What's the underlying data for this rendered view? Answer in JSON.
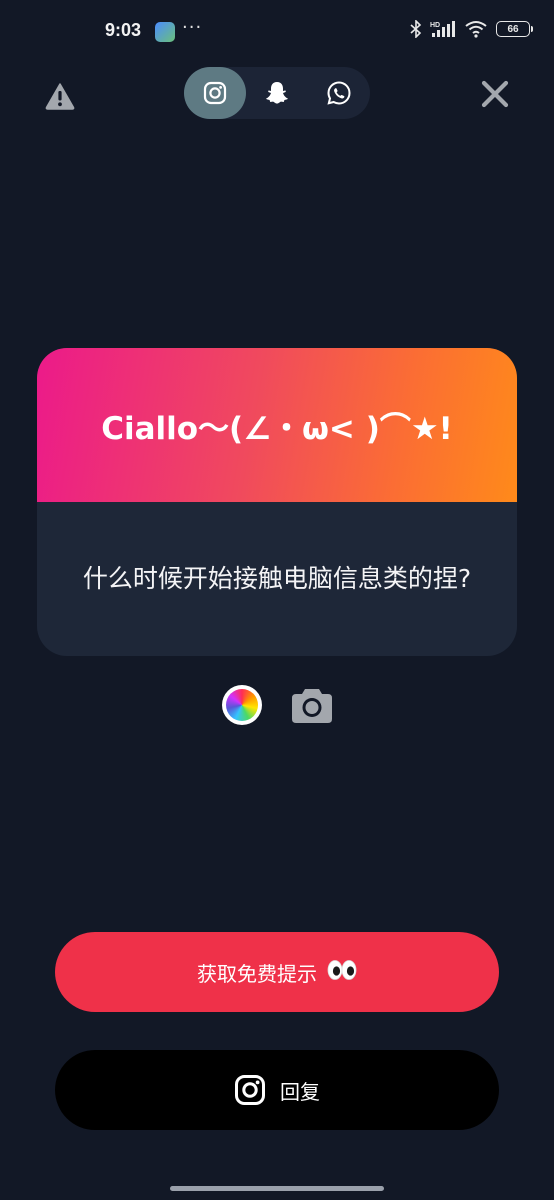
{
  "status_bar": {
    "time": "9:03",
    "dots": "···",
    "battery": "66",
    "network_label": "HD"
  },
  "top_bar": {
    "warning_icon": "warning-icon",
    "close_icon": "close-icon",
    "share_options": [
      {
        "name": "instagram",
        "icon": "instagram-icon",
        "active": true
      },
      {
        "name": "snapchat",
        "icon": "snapchat-icon",
        "active": false
      },
      {
        "name": "whatsapp",
        "icon": "whatsapp-icon",
        "active": false
      }
    ]
  },
  "card": {
    "title": "Ciallo～(∠・ω< )⌒★!",
    "question": "什么时候开始接触电脑信息类的捏?",
    "gradient_colors": [
      "#ec1a8a",
      "#ff8a1a"
    ]
  },
  "tools": {
    "color_picker_icon": "color-wheel-icon",
    "camera_icon": "camera-icon"
  },
  "buttons": {
    "hint_label": "获取免费提示",
    "hint_emoji": "👀",
    "reply_label": "回复"
  },
  "colors": {
    "background": "#121826",
    "hint_button": "#ef3149",
    "reply_button": "#000000",
    "card_body": "#1e2738",
    "active_tab": "#5e7a83"
  }
}
